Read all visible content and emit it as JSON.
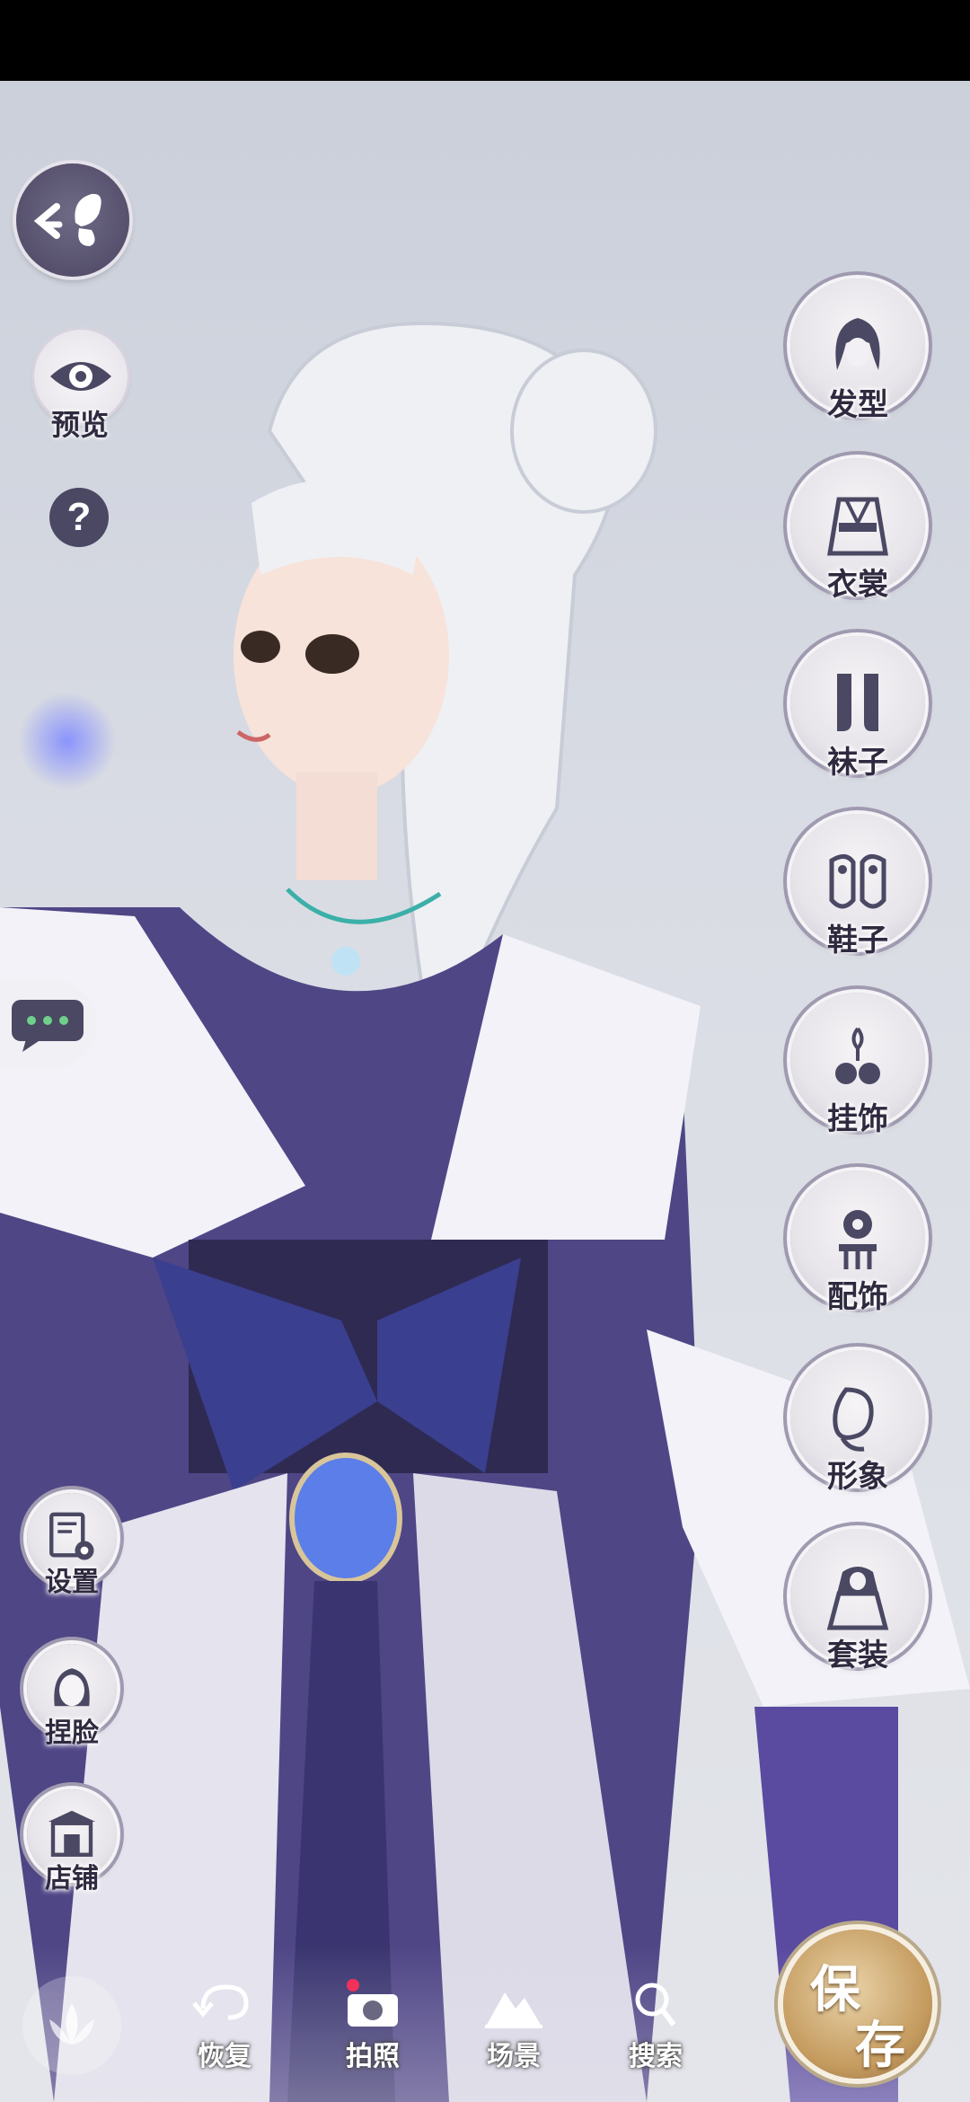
{
  "left_panel": {
    "preview_label": "预览",
    "help_glyph": "?",
    "settings_label": "设置",
    "face_label": "捏脸",
    "shop_label": "店铺"
  },
  "right_panel": {
    "items": [
      {
        "label": "发型",
        "icon": "hairstyle-icon"
      },
      {
        "label": "衣裳",
        "icon": "clothing-icon"
      },
      {
        "label": "袜子",
        "icon": "socks-icon"
      },
      {
        "label": "鞋子",
        "icon": "shoes-icon"
      },
      {
        "label": "挂饰",
        "icon": "pendant-icon"
      },
      {
        "label": "配饰",
        "icon": "accessory-icon"
      },
      {
        "label": "形象",
        "icon": "appearance-icon"
      },
      {
        "label": "套装",
        "icon": "outfit-set-icon"
      }
    ]
  },
  "bottom_bar": {
    "restore_label": "恢复",
    "photo_label": "拍照",
    "scene_label": "场景",
    "search_label": "搜索"
  },
  "save": {
    "char1": "保",
    "char2": "存"
  },
  "colors": {
    "accent_dark": "#4a4862",
    "label_text": "#2f2a3f",
    "save_gold": "#c49a5e",
    "status_bar": "#000000"
  }
}
